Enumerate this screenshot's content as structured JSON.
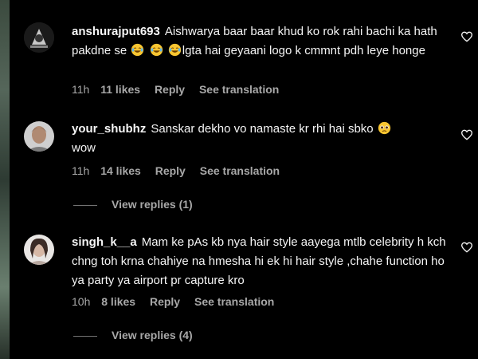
{
  "comments": [
    {
      "username": "anshurajput693",
      "text_a": "Aishwarya baar baar khud ko rok rahi bachi ka hath pakdne se",
      "text_b": "lgta hai geyaani logo k cmmnt pdh leye honge",
      "time": "11h",
      "likes": "11 likes",
      "reply": "Reply",
      "translate": "See translation"
    },
    {
      "username": "your_shubhz",
      "text": "Sanskar dekho vo namaste kr rhi hai sbko",
      "text_end": "wow",
      "time": "11h",
      "likes": "14 likes",
      "reply": "Reply",
      "translate": "See translation",
      "view_replies": "View replies (1)"
    },
    {
      "username": "singh_k__a",
      "text": "Mam ke pAs kb nya hair style aayega mtlb celebrity h kch chng toh krna chahiye na hmesha hi ek hi hair style ,chahe function ho ya party ya airport pr capture kro",
      "time": "10h",
      "likes": "8 likes",
      "reply": "Reply",
      "translate": "See translation",
      "view_replies": "View replies (4)"
    }
  ],
  "icons": {
    "like": "heart-outline-icon",
    "laugh_emoji": "face-with-tears-of-joy",
    "pleading_emoji": "pleading-face"
  },
  "colors": {
    "background": "#000000",
    "text": "#f5f5f5",
    "secondary": "#a8a8a8"
  }
}
